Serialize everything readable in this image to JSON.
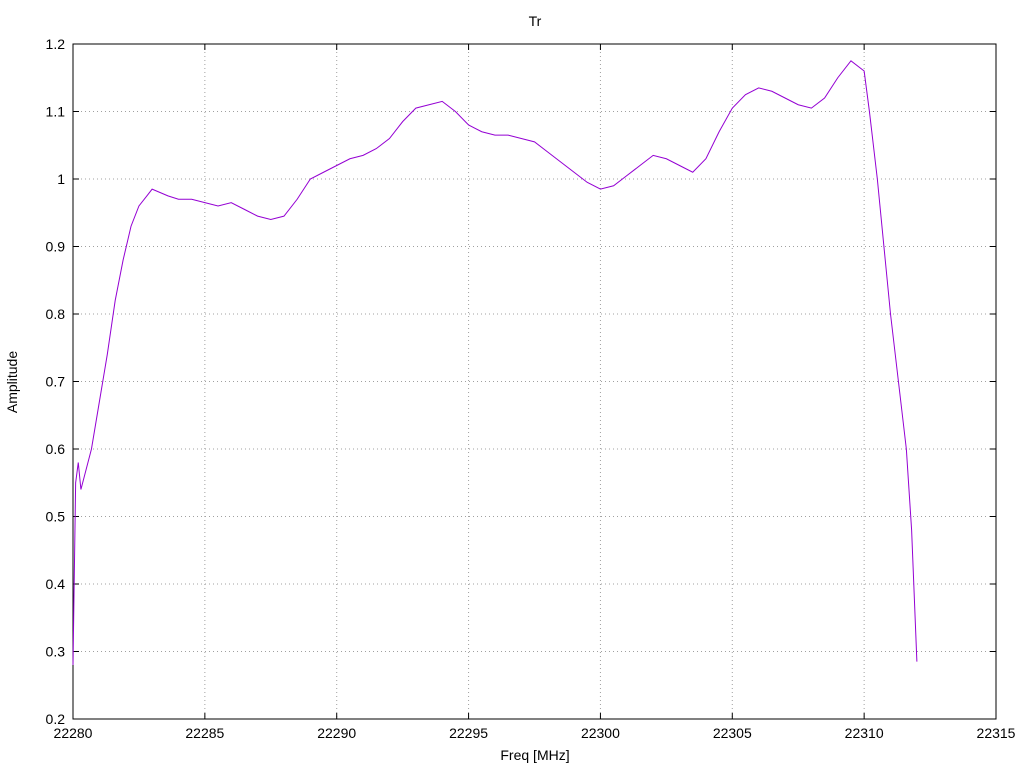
{
  "chart_data": {
    "type": "line",
    "title": "Tr",
    "xlabel": "Freq [MHz]",
    "ylabel": "Amplitude",
    "xlim": [
      22280,
      22315
    ],
    "ylim": [
      0.2,
      1.2
    ],
    "xticks": [
      22280,
      22285,
      22290,
      22295,
      22300,
      22305,
      22310,
      22315
    ],
    "yticks": [
      0.2,
      0.3,
      0.4,
      0.5,
      0.6,
      0.7,
      0.8,
      0.9,
      1.0,
      1.1,
      1.2
    ],
    "ytick_labels": [
      "0.2",
      "0.3",
      "0.4",
      "0.5",
      "0.6",
      "0.7",
      "0.8",
      "0.9",
      "1",
      "1.1",
      "1.2"
    ],
    "grid": true,
    "series": [
      {
        "color": "#9400d3",
        "x": [
          22280.0,
          22280.1,
          22280.2,
          22280.3,
          22280.5,
          22280.7,
          22281.0,
          22281.3,
          22281.6,
          22281.9,
          22282.2,
          22282.5,
          22282.8,
          22283.0,
          22283.3,
          22283.6,
          22284.0,
          22284.5,
          22285.0,
          22285.5,
          22286.0,
          22286.5,
          22287.0,
          22287.5,
          22288.0,
          22288.5,
          22289.0,
          22289.5,
          22290.0,
          22290.5,
          22291.0,
          22291.5,
          22292.0,
          22292.5,
          22293.0,
          22293.5,
          22294.0,
          22294.5,
          22295.0,
          22295.5,
          22296.0,
          22296.5,
          22297.0,
          22297.5,
          22298.0,
          22298.5,
          22299.0,
          22299.5,
          22300.0,
          22300.5,
          22301.0,
          22301.5,
          22302.0,
          22302.5,
          22303.0,
          22303.5,
          22304.0,
          22304.5,
          22305.0,
          22305.5,
          22306.0,
          22306.5,
          22307.0,
          22307.5,
          22308.0,
          22308.5,
          22309.0,
          22309.5,
          22310.0,
          22310.2,
          22310.5,
          22310.8,
          22311.0,
          22311.3,
          22311.6,
          22311.8,
          22312.0
        ],
        "y": [
          0.28,
          0.55,
          0.58,
          0.54,
          0.57,
          0.6,
          0.67,
          0.74,
          0.82,
          0.88,
          0.93,
          0.96,
          0.975,
          0.985,
          0.98,
          0.975,
          0.97,
          0.97,
          0.965,
          0.96,
          0.965,
          0.955,
          0.945,
          0.94,
          0.945,
          0.97,
          1.0,
          1.01,
          1.02,
          1.03,
          1.035,
          1.045,
          1.06,
          1.085,
          1.105,
          1.11,
          1.115,
          1.1,
          1.08,
          1.07,
          1.065,
          1.065,
          1.06,
          1.055,
          1.04,
          1.025,
          1.01,
          0.995,
          0.985,
          0.99,
          1.005,
          1.02,
          1.035,
          1.03,
          1.02,
          1.01,
          1.03,
          1.07,
          1.105,
          1.125,
          1.135,
          1.13,
          1.12,
          1.11,
          1.105,
          1.12,
          1.15,
          1.175,
          1.16,
          1.1,
          1.0,
          0.88,
          0.8,
          0.7,
          0.6,
          0.48,
          0.285
        ]
      }
    ]
  }
}
